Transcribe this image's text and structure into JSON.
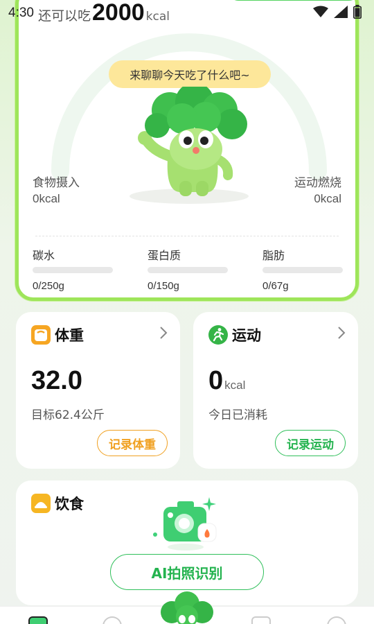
{
  "status_bar": {
    "time": "4:30",
    "icons": [
      "wifi-icon",
      "signal-icon",
      "battery-icon"
    ]
  },
  "hero": {
    "remaining_prefix": "还可以吃",
    "remaining_value": "2000",
    "remaining_unit": "kcal",
    "bubble_text": "来聊聊今天吃了什么吧~",
    "intake_label": "食物摄入",
    "intake_value": "0kcal",
    "burn_label": "运动燃烧",
    "burn_value": "0kcal",
    "macros": [
      {
        "label": "碳水",
        "value": "0/250g",
        "progress": 0
      },
      {
        "label": "蛋白质",
        "value": "0/150g",
        "progress": 0
      },
      {
        "label": "脂肪",
        "value": "0/67g",
        "progress": 0
      }
    ]
  },
  "weight_card": {
    "title": "体重",
    "value": "32.0",
    "subtitle": "目标62.4公斤",
    "button": "记录体重",
    "icon": "scale-icon",
    "accent": "#f39c12"
  },
  "exercise_card": {
    "title": "运动",
    "value": "0",
    "unit": "kcal",
    "subtitle": "今日已消耗",
    "button": "记录运动",
    "icon": "running-icon",
    "accent": "#2fbf5a"
  },
  "diet_card": {
    "title": "饮食",
    "icon": "meal-icon",
    "ai_button": "AI拍照识别"
  },
  "colors": {
    "brand_green": "#53d35f",
    "card_border": "#9ee55a",
    "bubble": "#fde79a"
  }
}
